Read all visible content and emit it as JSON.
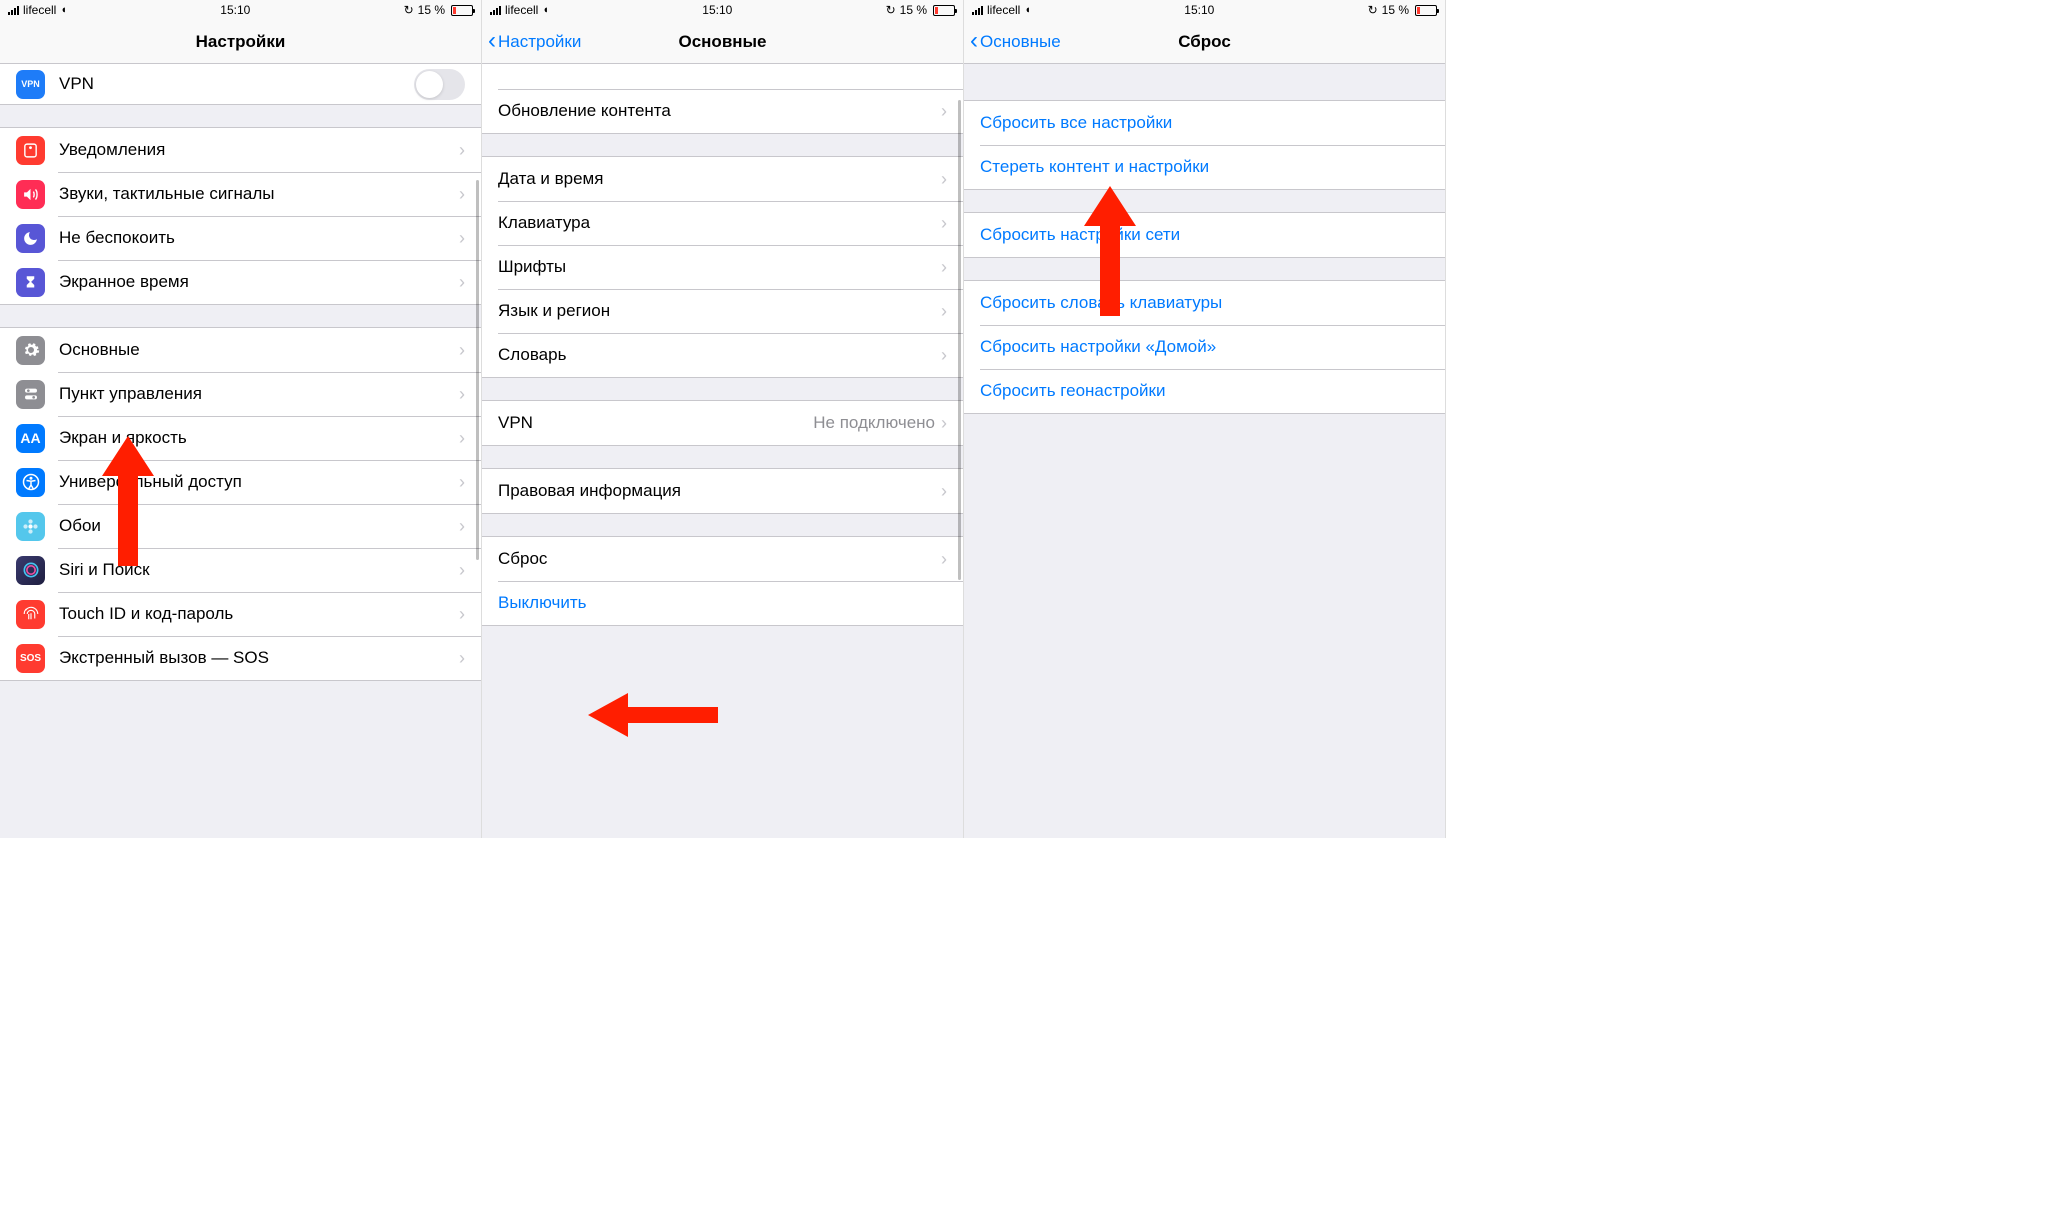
{
  "status": {
    "carrier": "lifecell",
    "time": "15:10",
    "battery_text": "15 %"
  },
  "screen1": {
    "title": "Настройки",
    "vpn": "VPN",
    "notifications": "Уведомления",
    "sounds": "Звуки, тактильные сигналы",
    "dnd": "Не беспокоить",
    "screentime": "Экранное время",
    "general": "Основные",
    "control_center": "Пункт управления",
    "display": "Экран и яркость",
    "accessibility": "Универсальный доступ",
    "wallpaper": "Обои",
    "siri": "Siri и Поиск",
    "touchid": "Touch ID и код-пароль",
    "emergency": "Экстренный вызов — SOS"
  },
  "screen2": {
    "back": "Настройки",
    "title": "Основные",
    "content_refresh": "Обновление контента",
    "date_time": "Дата и время",
    "keyboard": "Клавиатура",
    "fonts": "Шрифты",
    "language": "Язык и регион",
    "dictionary": "Словарь",
    "vpn": "VPN",
    "vpn_value": "Не подключено",
    "legal": "Правовая информация",
    "reset": "Сброс",
    "shutdown": "Выключить"
  },
  "screen3": {
    "back": "Основные",
    "title": "Сброс",
    "reset_all": "Сбросить все настройки",
    "erase_all": "Стереть контент и настройки",
    "reset_network": "Сбросить настройки сети",
    "reset_keyboard": "Сбросить словарь клавиатуры",
    "reset_home": "Сбросить настройки «Домой»",
    "reset_location": "Сбросить геонастройки"
  }
}
